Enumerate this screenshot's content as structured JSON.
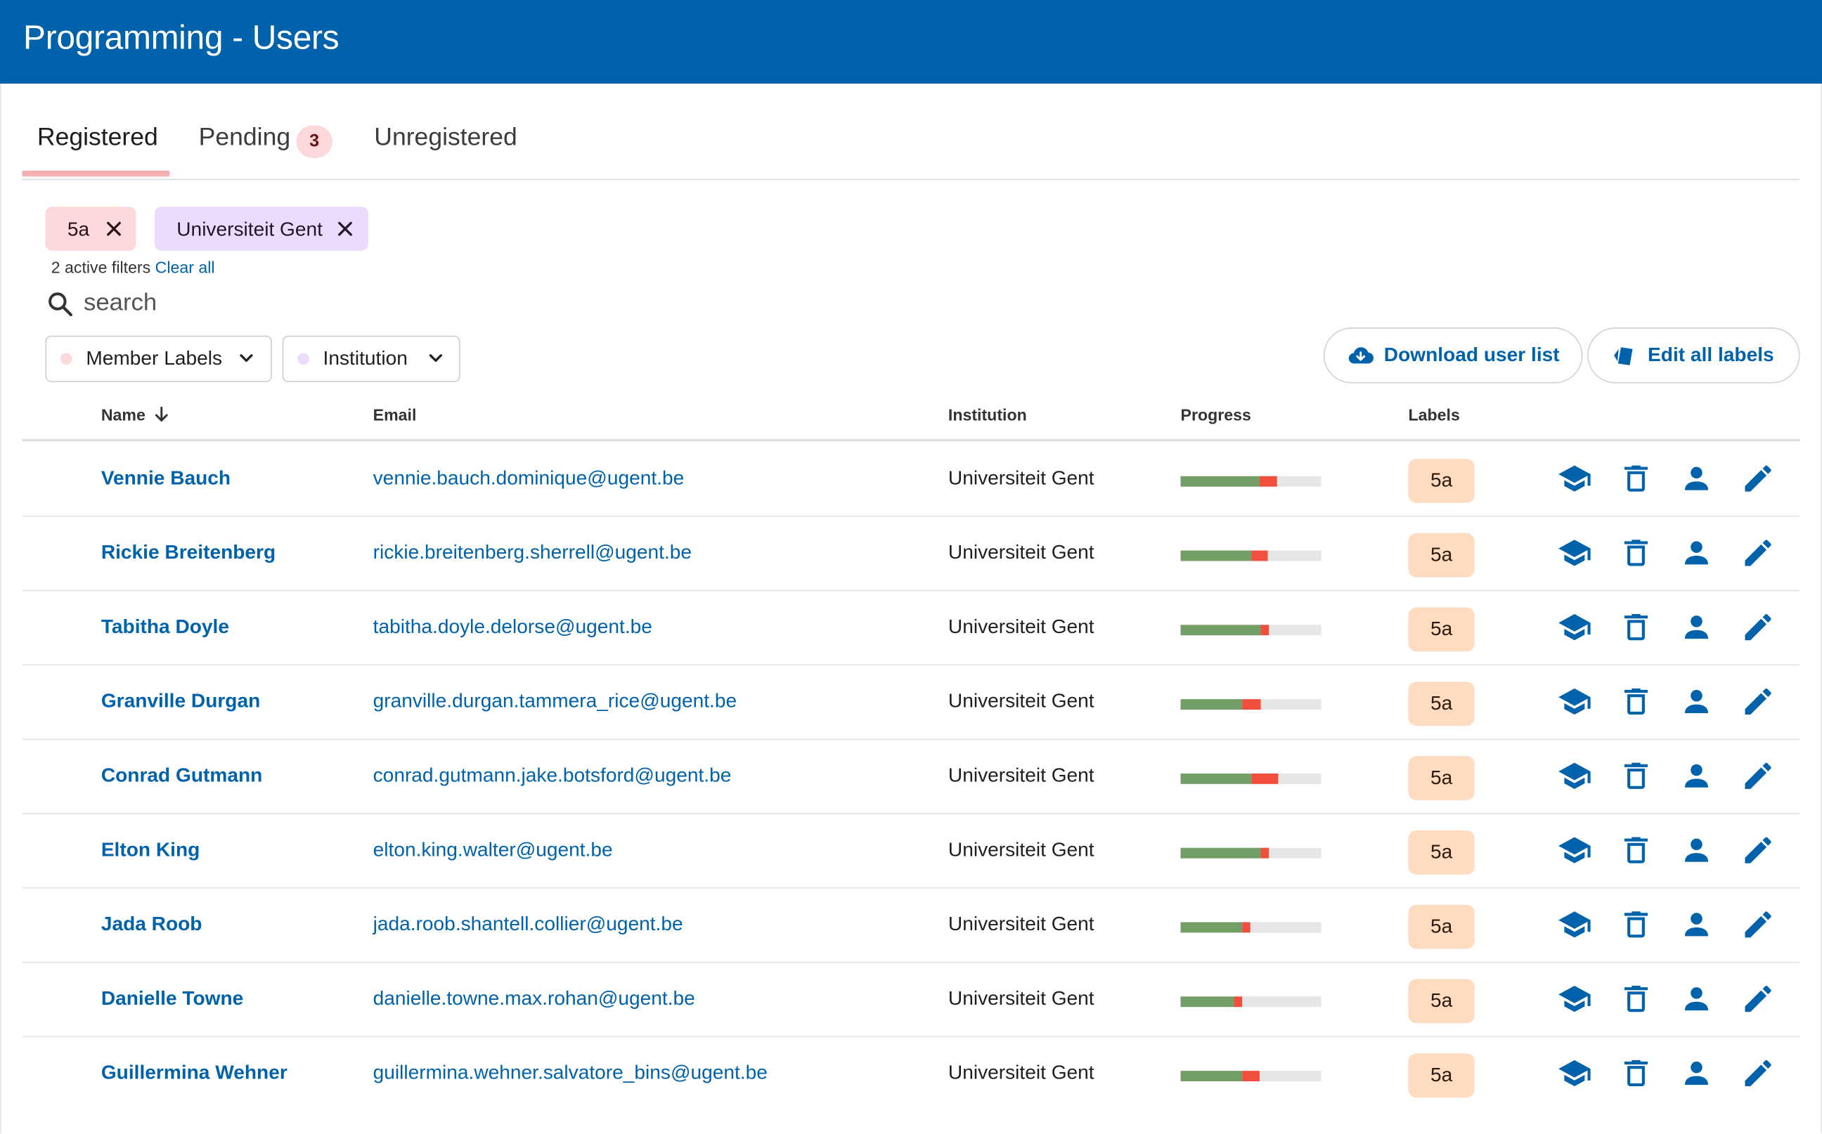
{
  "app": {
    "title": "Programming - Users"
  },
  "tabs": [
    {
      "label": "Registered",
      "active": true
    },
    {
      "label": "Pending",
      "badge": "3"
    },
    {
      "label": "Unregistered"
    }
  ],
  "active_filters": [
    {
      "label": "5a",
      "color": "#fcdadc"
    },
    {
      "label": "Universiteit Gent",
      "color": "#eadcfa"
    }
  ],
  "filters_info": {
    "text": "2 active filters",
    "clear_label": "Clear all"
  },
  "search": {
    "placeholder": "search",
    "value": ""
  },
  "dropdowns": [
    {
      "label": "Member Labels",
      "dot_color": "#fcdadc"
    },
    {
      "label": "Institution",
      "dot_color": "#eadcfa"
    }
  ],
  "actions": {
    "download_label": "Download user list",
    "edit_labels_label": "Edit all labels"
  },
  "table": {
    "columns": {
      "name": "Name",
      "email": "Email",
      "institution": "Institution",
      "progress": "Progress",
      "labels": "Labels"
    },
    "sort": {
      "column": "name",
      "direction": "descending-arrow"
    },
    "row_action_icons": [
      "school-icon",
      "trash-icon",
      "person-icon",
      "pencil-icon"
    ],
    "rows": [
      {
        "name": "Vennie Bauch",
        "email": "vennie.bauch.dominique@ugent.be",
        "institution": "Universiteit Gent",
        "progress_correct": 0.56,
        "progress_wrong": 0.13,
        "label": "5a"
      },
      {
        "name": "Rickie Breitenberg",
        "email": "rickie.breitenberg.sherrell@ugent.be",
        "institution": "Universiteit Gent",
        "progress_correct": 0.5,
        "progress_wrong": 0.12,
        "label": "5a"
      },
      {
        "name": "Tabitha Doyle",
        "email": "tabitha.doyle.delorse@ugent.be",
        "institution": "Universiteit Gent",
        "progress_correct": 0.57,
        "progress_wrong": 0.06,
        "label": "5a"
      },
      {
        "name": "Granville Durgan",
        "email": "granville.durgan.tammera_rice@ugent.be",
        "institution": "Universiteit Gent",
        "progress_correct": 0.44,
        "progress_wrong": 0.13,
        "label": "5a"
      },
      {
        "name": "Conrad Gutmann",
        "email": "conrad.gutmann.jake.botsford@ugent.be",
        "institution": "Universiteit Gent",
        "progress_correct": 0.5,
        "progress_wrong": 0.19,
        "label": "5a"
      },
      {
        "name": "Elton King",
        "email": "elton.king.walter@ugent.be",
        "institution": "Universiteit Gent",
        "progress_correct": 0.57,
        "progress_wrong": 0.06,
        "label": "5a"
      },
      {
        "name": "Jada Roob",
        "email": "jada.roob.shantell.collier@ugent.be",
        "institution": "Universiteit Gent",
        "progress_correct": 0.44,
        "progress_wrong": 0.06,
        "label": "5a"
      },
      {
        "name": "Danielle Towne",
        "email": "danielle.towne.max.rohan@ugent.be",
        "institution": "Universiteit Gent",
        "progress_correct": 0.38,
        "progress_wrong": 0.06,
        "label": "5a"
      },
      {
        "name": "Guillermina Wehner",
        "email": "guillermina.wehner.salvatore_bins@ugent.be",
        "institution": "Universiteit Gent",
        "progress_correct": 0.44,
        "progress_wrong": 0.12,
        "label": "5a"
      }
    ]
  },
  "colors": {
    "brand": "#0062aa",
    "progress_correct": "#739e65",
    "progress_wrong": "#f24e3d",
    "label_bg": "#ffdbc0"
  }
}
